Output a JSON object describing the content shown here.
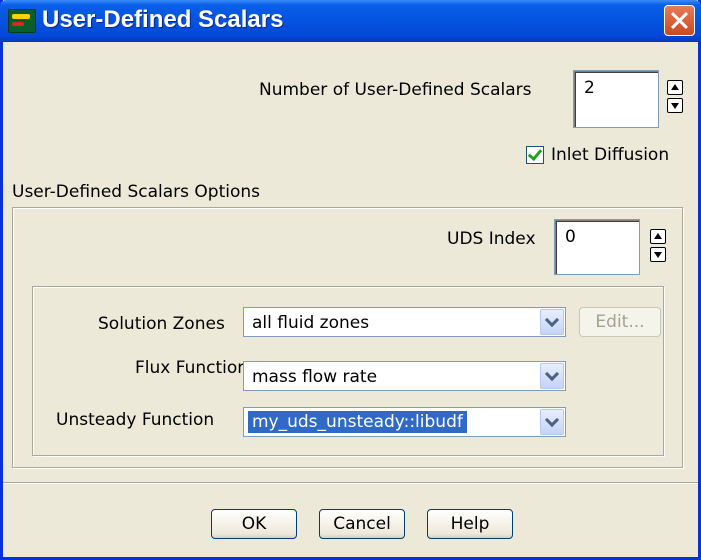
{
  "window": {
    "title": "User-Defined Scalars"
  },
  "number_of_scalars": {
    "label": "Number of User-Defined Scalars",
    "value": "2"
  },
  "inlet_diffusion": {
    "label": "Inlet Diffusion",
    "checked": true
  },
  "options_group": {
    "label": "User-Defined Scalars Options"
  },
  "uds_index": {
    "label": "UDS Index",
    "value": "0"
  },
  "solution_zones": {
    "label": "Solution Zones",
    "value": "all fluid zones",
    "edit_label": "Edit..."
  },
  "flux_function": {
    "label": "Flux Function",
    "value": "mass flow rate"
  },
  "unsteady_function": {
    "label": "Unsteady Function",
    "value": "my_uds_unsteady::libudf"
  },
  "buttons": {
    "ok": "OK",
    "cancel": "Cancel",
    "help": "Help"
  },
  "colors": {
    "title_bar": "#0553e0",
    "dialog_bg": "#ece9d8",
    "selection": "#316ac5",
    "close_button": "#c94a21"
  }
}
